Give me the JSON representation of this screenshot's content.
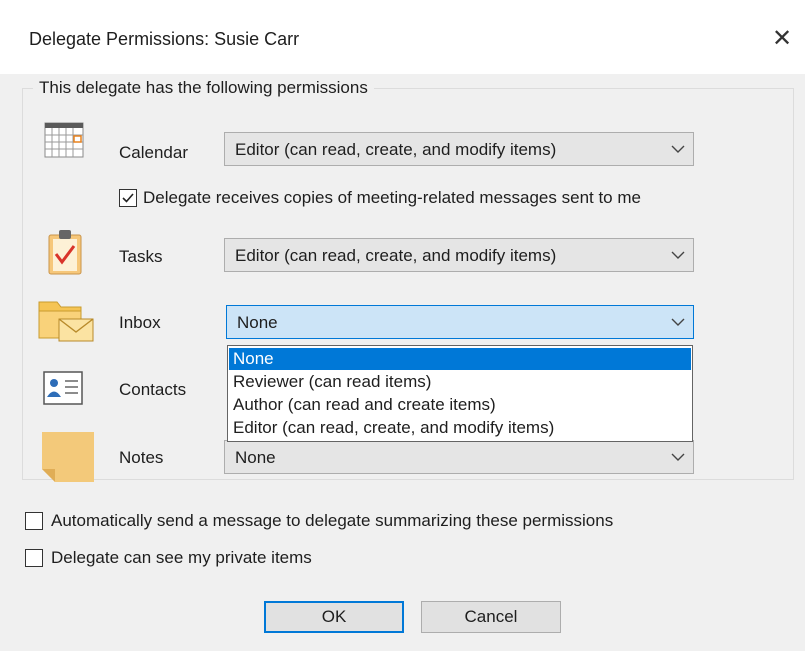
{
  "dialog": {
    "title": "Delegate Permissions: Susie Carr",
    "close_glyph": "✕"
  },
  "permissions_group": {
    "legend": "This delegate has the following permissions",
    "rows": [
      {
        "label": "Calendar",
        "value": "Editor (can read, create, and modify items)",
        "icon": "calendar-icon"
      },
      {
        "label": "Tasks",
        "value": "Editor (can read, create, and modify items)",
        "icon": "tasks-icon"
      },
      {
        "label": "Inbox",
        "value": "None",
        "icon": "inbox-icon"
      },
      {
        "label": "Contacts",
        "value": "",
        "icon": "contacts-icon"
      },
      {
        "label": "Notes",
        "value": "None",
        "icon": "notes-icon"
      }
    ],
    "meeting_copies": {
      "label": "Delegate receives copies of meeting-related messages sent to me",
      "checked": true
    }
  },
  "inbox_dropdown": {
    "options": [
      "None",
      "Reviewer (can read items)",
      "Author (can read and create items)",
      "Editor (can read, create, and modify items)"
    ],
    "selected_index": 0
  },
  "options": {
    "auto_send": {
      "label": "Automatically send a message to delegate summarizing these permissions",
      "checked": false
    },
    "private_items": {
      "label": "Delegate can see my private items",
      "checked": false
    }
  },
  "buttons": {
    "ok": "OK",
    "cancel": "Cancel"
  },
  "colors": {
    "accent": "#0078d7",
    "dialog_bg": "#f0f0f0",
    "combo_bg": "#e5e5e5",
    "focused_combo_bg": "#cce4f7"
  }
}
